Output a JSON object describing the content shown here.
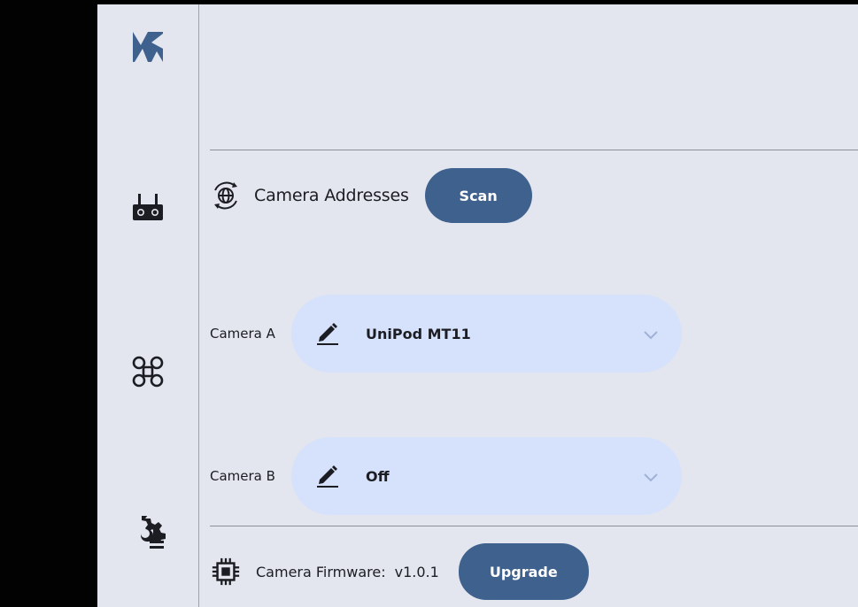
{
  "rail": {
    "items": [
      {
        "name": "camera-icon"
      },
      {
        "name": "remote-controller-icon"
      },
      {
        "name": "drone-icon"
      },
      {
        "name": "settings-list-icon"
      }
    ]
  },
  "camera_addresses": {
    "title": "Camera Addresses",
    "scan_label": "Scan",
    "icon": "network-sync-icon"
  },
  "cameras": [
    {
      "label": "Camera A",
      "value": "UniPod MT11"
    },
    {
      "label": "Camera B",
      "value": "Off"
    }
  ],
  "firmware": {
    "label": "Camera Firmware:",
    "version": "v1.0.1",
    "upgrade_label": "Upgrade",
    "icon": "chip-icon"
  },
  "colors": {
    "accent": "#3f618e",
    "dropdown_bg": "#d6e2fb",
    "surface": "#e3e5ef"
  }
}
